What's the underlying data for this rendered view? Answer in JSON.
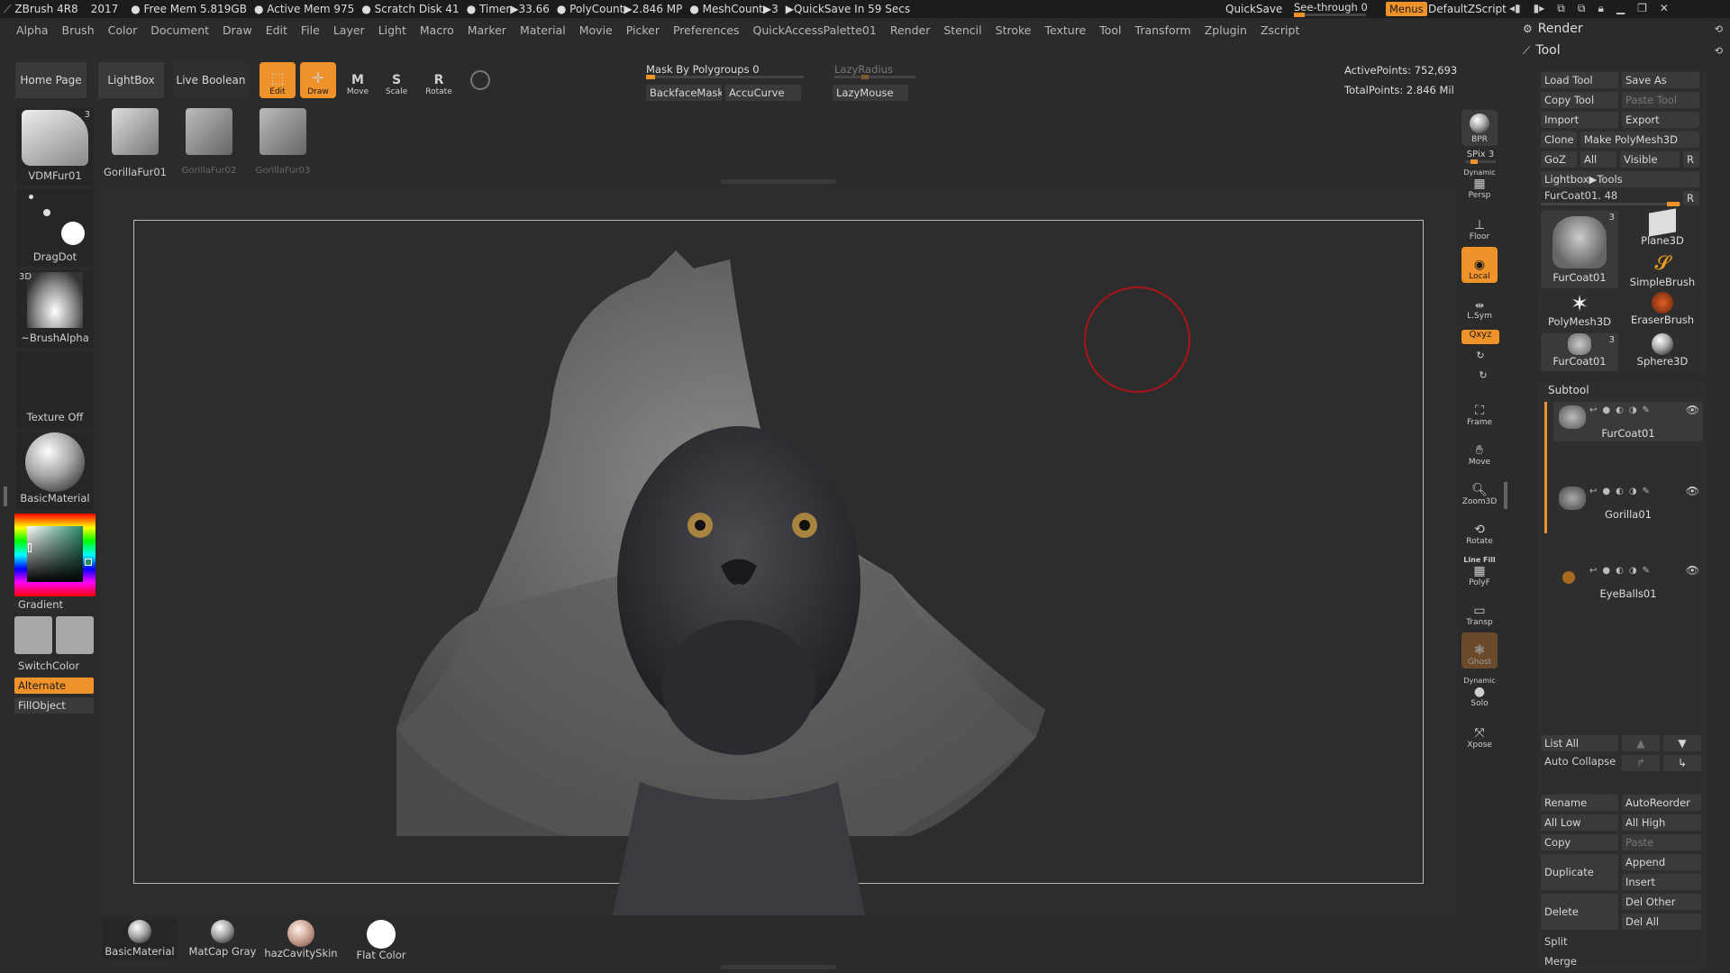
{
  "titlebar": {
    "app": "ZBrush 4R8",
    "year": "2017",
    "free_mem": "● Free Mem 5.819GB",
    "active_mem": "● Active Mem 975",
    "scratch": "● Scratch Disk 41",
    "timer": "● Timer▶33.66",
    "polycount": "● PolyCount▶2.846 MP",
    "meshcount": "● MeshCount▶3",
    "quicksave_in": "▶QuickSave In 59 Secs",
    "quicksave": "QuickSave",
    "seethrough": "See-through  0",
    "menus": "Menus",
    "script": "DefaultZScript"
  },
  "menus": [
    "Alpha",
    "Brush",
    "Color",
    "Document",
    "Draw",
    "Edit",
    "File",
    "Layer",
    "Light",
    "Macro",
    "Marker",
    "Material",
    "Movie",
    "Picker",
    "Preferences",
    "QuickAccessPalette01",
    "Render",
    "Stencil",
    "Stroke",
    "Texture",
    "Tool",
    "Transform",
    "Zplugin",
    "Zscript"
  ],
  "top_shelf": {
    "home": "Home Page",
    "lightbox": "LightBox",
    "live_boolean": "Live Boolean",
    "edit": "Edit",
    "draw": "Draw",
    "move": "Move",
    "scale": "Scale",
    "rotate": "Rotate",
    "mask_polygroups": "Mask By Polygroups 0",
    "backface": "BackfaceMask",
    "accucurve": "AccuCurve",
    "lazyradius": "LazyRadius",
    "lazymouse": "LazyMouse",
    "active_points": "ActivePoints: 752,693",
    "total_points": "TotalPoints: 2.846 Mil"
  },
  "brush_thumbs": [
    {
      "label": "GorillaFur01",
      "dim": false
    },
    {
      "label": "GorillaFur02",
      "dim": true
    },
    {
      "label": "GorillaFur03",
      "dim": true
    }
  ],
  "left_shelf": {
    "brush": "VDMFur01",
    "brush_count": "3",
    "stroke": "DragDot",
    "alpha_tag": "3D",
    "alpha": "~BrushAlpha",
    "texture": "Texture Off",
    "material": "BasicMaterial",
    "gradient": "Gradient",
    "switchcolor": "SwitchColor",
    "alternate": "Alternate",
    "fillobject": "FillObject"
  },
  "right_shelf": {
    "bpr": "BPR",
    "spix": "SPix 3",
    "dynamic": "Dynamic",
    "persp": "Persp",
    "floor": "Floor",
    "local": "Local",
    "lsym": "L.Sym",
    "xyz": "Qxyz",
    "frame": "Frame",
    "move": "Move",
    "zoom3d": "Zoom3D",
    "rotate": "Rotate",
    "linefill": "Line Fill",
    "polyf": "PolyF",
    "transp": "Transp",
    "ghost": "Ghost",
    "dynamic2": "Dynamic",
    "solo": "Solo",
    "xpose": "Xpose"
  },
  "tool_panel": {
    "render": "Render",
    "tool": "Tool",
    "load_tool": "Load Tool",
    "save_as": "Save As",
    "copy_tool": "Copy Tool",
    "paste_tool": "Paste Tool",
    "import": "Import",
    "export": "Export",
    "clone": "Clone",
    "make_polymesh": "Make PolyMesh3D",
    "goz": "GoZ",
    "all": "All",
    "visible": "Visible",
    "r": "R",
    "lightbox_tools": "Lightbox▶Tools",
    "current_tool": "FurCoat01. 48",
    "tools": [
      {
        "label": "FurCoat01",
        "count": "3"
      },
      {
        "label": "Plane3D"
      },
      {
        "label": "SimpleBrush"
      },
      {
        "label": "PolyMesh3D"
      },
      {
        "label": "EraserBrush"
      },
      {
        "label": "FurCoat01",
        "count": "3"
      },
      {
        "label": "Sphere3D"
      }
    ]
  },
  "subtool": {
    "title": "Subtool",
    "items": [
      "FurCoat01",
      "Gorilla01",
      "EyeBalls01"
    ],
    "list_all": "List All",
    "auto_collapse": "Auto Collapse",
    "rename": "Rename",
    "autoreorder": "AutoReorder",
    "all_low": "All Low",
    "all_high": "All High",
    "copy": "Copy",
    "paste": "Paste",
    "duplicate": "Duplicate",
    "append": "Append",
    "insert": "Insert",
    "delete": "Delete",
    "del_other": "Del Other",
    "del_all": "Del All",
    "split": "Split",
    "merge": "Merge"
  },
  "materials": [
    "BasicMaterial",
    "MatCap Gray",
    "hazCavitySkin",
    "Flat Color"
  ],
  "colors": {
    "accent": "#f0922a",
    "bg": "#2b2b2b"
  }
}
